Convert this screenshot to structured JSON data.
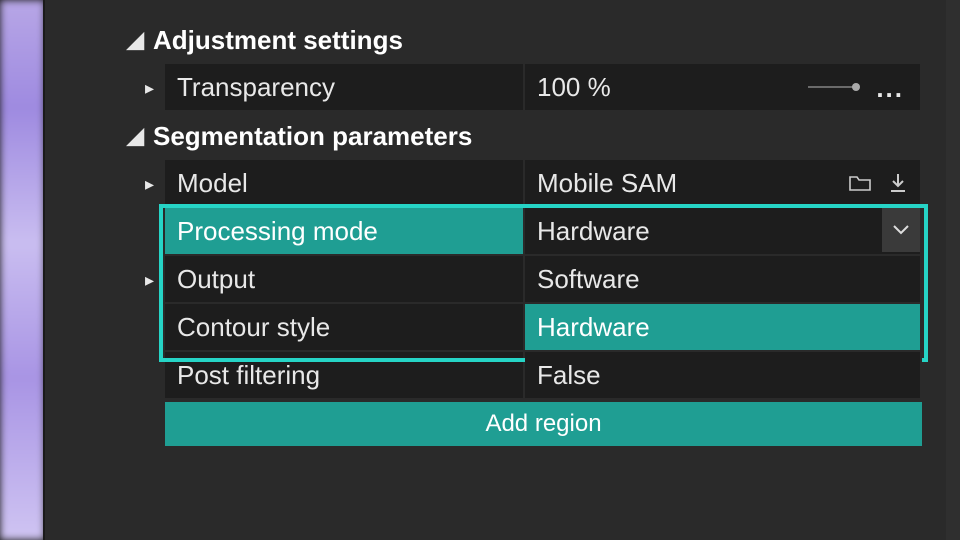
{
  "sections": {
    "adjustment": {
      "title": "Adjustment settings",
      "transparency": {
        "label": "Transparency",
        "value": "100 %"
      }
    },
    "segmentation": {
      "title": "Segmentation parameters",
      "model": {
        "label": "Model",
        "value": "Mobile SAM"
      },
      "processing_mode": {
        "label": "Processing mode",
        "value": "Hardware",
        "options": {
          "software": "Software",
          "hardware": "Hardware"
        }
      },
      "output": {
        "label": "Output"
      },
      "contour_style": {
        "label": "Contour style"
      },
      "post_filtering": {
        "label": "Post filtering",
        "value": "False"
      },
      "add_region": "Add region"
    }
  },
  "icons": {
    "folder": "folder-icon",
    "download": "download-icon",
    "more": "..."
  },
  "colors": {
    "accent": "#1f9e93",
    "highlight": "#26d4c6"
  }
}
